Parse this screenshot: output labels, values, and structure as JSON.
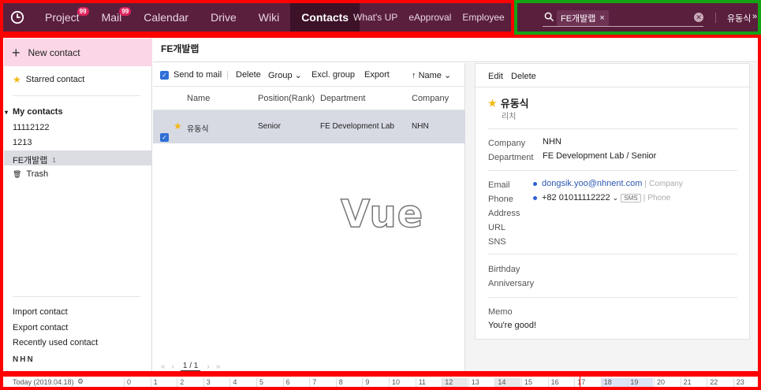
{
  "top_nav": {
    "items": [
      {
        "label": "Project",
        "badge": "99"
      },
      {
        "label": "Mail",
        "badge": "99"
      },
      {
        "label": "Calendar"
      },
      {
        "label": "Drive"
      },
      {
        "label": "Wiki"
      },
      {
        "label": "Contacts",
        "active": true
      }
    ],
    "small_items": [
      "What's UP",
      "eApproval",
      "Employee"
    ],
    "search_chip": "FE개발랩",
    "user_name": "유동식"
  },
  "sidebar": {
    "new_contact": "New contact",
    "starred": "Starred contact",
    "my_contacts": "My contacts",
    "groups": [
      "11112122",
      "1213",
      "FE개발랩"
    ],
    "selected_count": "1",
    "trash": "Trash",
    "footer_links": [
      "Import contact",
      "Export contact",
      "Recently used contact"
    ],
    "brand": "NHN"
  },
  "header": {
    "title": "FE개발랩"
  },
  "list": {
    "toolbar": {
      "send_to_mail": "Send to mail",
      "delete": "Delete",
      "group": "Group",
      "excl_group": "Excl. group",
      "export": "Export",
      "sort": "Name"
    },
    "columns": [
      "Name",
      "Position(Rank)",
      "Department",
      "Company"
    ],
    "rows": [
      {
        "name": "유동식",
        "position": "Senior",
        "department": "FE Development Lab",
        "company": "NHN"
      }
    ],
    "overlay_text": "Vue",
    "pager": "1 / 1"
  },
  "detail": {
    "toolbar": {
      "edit": "Edit",
      "delete": "Delete"
    },
    "name": "유동식",
    "subtitle": "리치",
    "company_label": "Company",
    "company": "NHN",
    "department_label": "Department",
    "department": "FE Development Lab / Senior",
    "email_label": "Email",
    "email": "dongsik.yoo@nhnent.com",
    "email_type": "Company",
    "phone_label": "Phone",
    "phone": "+82 01011112222",
    "sms": "SMS",
    "phone_type": "Phone",
    "address_label": "Address",
    "url_label": "URL",
    "sns_label": "SNS",
    "birthday_label": "Birthday",
    "anniversary_label": "Anniversary",
    "memo_label": "Memo",
    "memo": "You're good!"
  },
  "timeline": {
    "today": "Today (2019.04.18)",
    "hours": [
      "0",
      "1",
      "2",
      "3",
      "4",
      "5",
      "6",
      "7",
      "8",
      "9",
      "10",
      "11",
      "12",
      "13",
      "14",
      "15",
      "16",
      "17",
      "18",
      "19",
      "20",
      "21",
      "22",
      "23"
    ]
  },
  "colors": {
    "topbar": "#5a1f3d",
    "accent": "#e0245e",
    "newbtn": "#fbd6e6",
    "link": "#2b57b3"
  }
}
